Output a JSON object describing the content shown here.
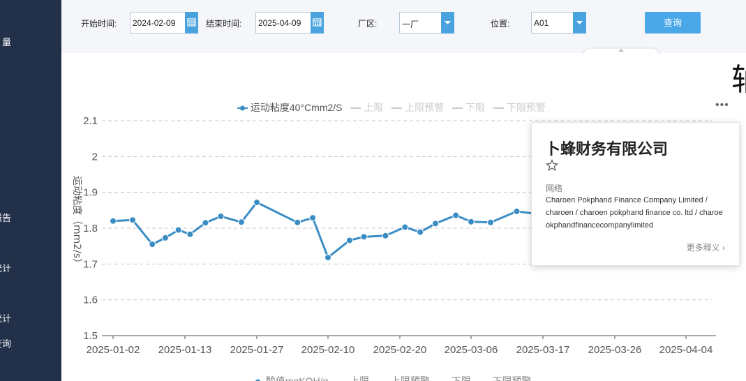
{
  "sidebar": {
    "items": [
      {
        "label": "量"
      },
      {
        "label": "报告"
      },
      {
        "label": "统计"
      },
      {
        "label": "统计"
      },
      {
        "label": "查询"
      }
    ]
  },
  "filters": {
    "start_label": "开始时间:",
    "start_value": "2024-02-09",
    "end_label": "结束时间:",
    "end_value": "2025-04-09",
    "plant_label": "厂区:",
    "plant_value": "一厂",
    "position_label": "位置:",
    "position_value": "A01",
    "query_label": "查询"
  },
  "header_char": "轴",
  "legend": {
    "series": "运动粘度40°Cmm2/S",
    "upper": "上限",
    "upper_warn": "上限预警",
    "lower": "下限",
    "lower_warn": "下限预警"
  },
  "bottom_legend": {
    "series": "酸值mgKOH/g",
    "upper": "上限",
    "upper_warn": "上限预警",
    "lower": "下限",
    "lower_warn": "下限预警"
  },
  "colors": {
    "series": "#3a8dc4",
    "legend_inactive": "#cccccc",
    "sidebar": "#22304a",
    "accent": "#4aa7e8"
  },
  "chart_data": {
    "type": "line",
    "ylabel": "运动粘度（mm2/s）",
    "ylim": [
      1.5,
      2.1
    ],
    "yticks": [
      "2.1",
      "2",
      "1.9",
      "1.8",
      "1.7",
      "1.6",
      "1.5"
    ],
    "xticks": [
      "2025-01-02",
      "2025-01-13",
      "2025-01-27",
      "2025-02-10",
      "2025-02-20",
      "2025-03-06",
      "2025-03-17",
      "2025-03-26",
      "2025-04-04"
    ],
    "grid": true,
    "series": [
      {
        "name": "运动粘度40°Cmm2/S",
        "x": [
          "2025-01-02",
          "2025-01-05",
          "2025-01-08",
          "2025-01-10",
          "2025-01-12",
          "2025-01-14",
          "2025-01-17",
          "2025-01-20",
          "2025-01-24",
          "2025-01-27",
          "2025-02-04",
          "2025-02-07",
          "2025-02-10",
          "2025-02-13",
          "2025-02-15",
          "2025-02-18",
          "2025-02-21",
          "2025-02-24",
          "2025-02-27",
          "2025-03-03",
          "2025-03-06",
          "2025-03-09",
          "2025-03-13",
          "2025-03-16"
        ],
        "values": [
          1.82,
          1.823,
          1.755,
          1.773,
          1.795,
          1.783,
          1.815,
          1.833,
          1.817,
          1.872,
          1.816,
          1.829,
          1.718,
          1.766,
          1.776,
          1.779,
          1.803,
          1.789,
          1.813,
          1.836,
          1.818,
          1.816,
          1.847,
          1.84
        ]
      }
    ]
  },
  "popup": {
    "title": "卜蜂财务有限公司",
    "category": "网络",
    "description": "Charoen Pokphand Finance Company Limited / charoen / charoen pokphand finance co. ltd / charoe okphandfinancecompanylimited",
    "more": "更多释义",
    "chevron": "›"
  }
}
